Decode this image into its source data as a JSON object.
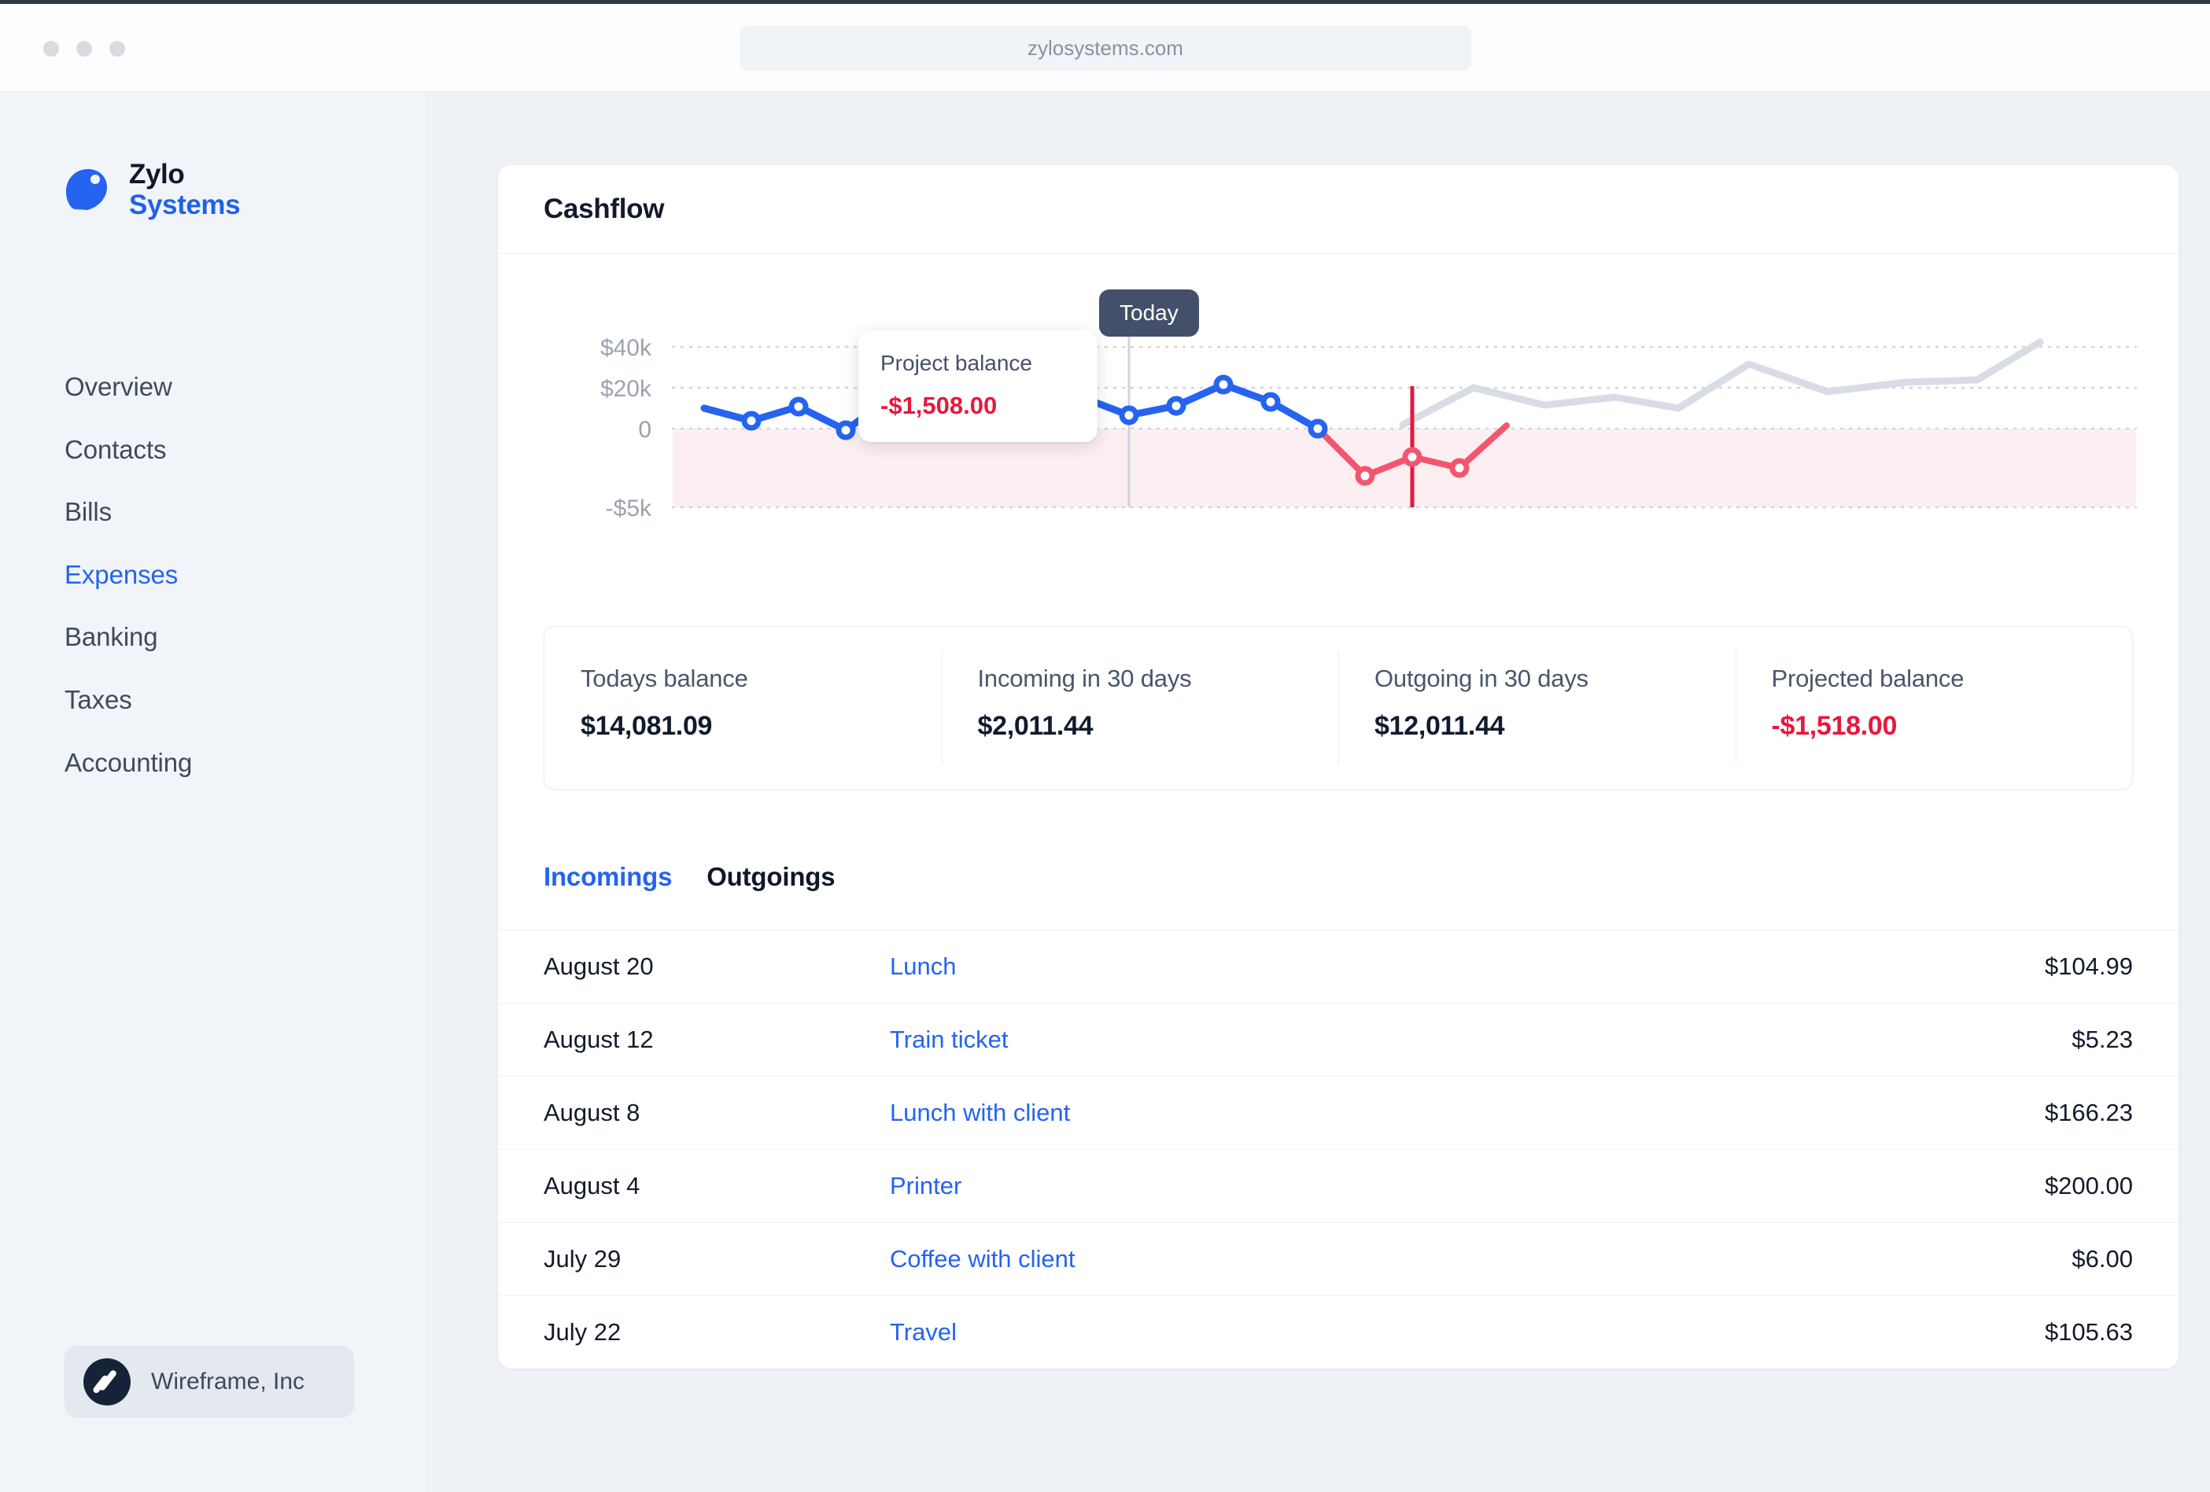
{
  "browser": {
    "url": "zylosystems.com"
  },
  "sidebar": {
    "brand": {
      "line1": "Zylo",
      "line2": "Systems"
    },
    "items": [
      {
        "label": "Overview",
        "active": false
      },
      {
        "label": "Contacts",
        "active": false
      },
      {
        "label": "Bills",
        "active": false
      },
      {
        "label": "Expenses",
        "active": true
      },
      {
        "label": "Banking",
        "active": false
      },
      {
        "label": "Taxes",
        "active": false
      },
      {
        "label": "Accounting",
        "active": false
      }
    ],
    "org": {
      "name": "Wireframe, Inc"
    }
  },
  "card": {
    "title": "Cashflow"
  },
  "chart_annotations": {
    "today_label": "Today",
    "tooltip_label": "Project balance",
    "tooltip_value": "-$1,508.00"
  },
  "stats": [
    {
      "label": "Todays balance",
      "value": "$14,081.09",
      "negative": false
    },
    {
      "label": "Incoming in 30 days",
      "value": "$2,011.44",
      "negative": false
    },
    {
      "label": "Outgoing in 30 days",
      "value": "$12,011.44",
      "negative": false
    },
    {
      "label": "Projected balance",
      "value": "-$1,518.00",
      "negative": true
    }
  ],
  "tabs": [
    {
      "label": "Incomings",
      "active": true
    },
    {
      "label": "Outgoings",
      "active": false
    }
  ],
  "transactions": [
    {
      "date": "August 20",
      "description": "Lunch",
      "amount": "$104.99"
    },
    {
      "date": "August 12",
      "description": "Train ticket",
      "amount": "$5.23"
    },
    {
      "date": "August 8",
      "description": "Lunch with client",
      "amount": "$166.23"
    },
    {
      "date": "August 4",
      "description": "Printer",
      "amount": "$200.00"
    },
    {
      "date": "July 29",
      "description": "Coffee with client",
      "amount": "$6.00"
    },
    {
      "date": "July 22",
      "description": "Travel",
      "amount": "$105.63"
    }
  ],
  "colors": {
    "accent": "#2563f0",
    "danger": "#e8173d",
    "danger_band": "#fdeef1",
    "projection": "#d8dde5",
    "today_pill": "#44506a"
  },
  "chart_data": {
    "type": "line",
    "title": "Cashflow",
    "xlabel": "",
    "ylabel": "",
    "ylim": [
      -5000,
      45000
    ],
    "yticks": [
      40000,
      20000,
      0,
      -5000
    ],
    "ytick_labels": [
      "$40k",
      "$20k",
      "0",
      "-$5k"
    ],
    "grid": "dotted-horizontal",
    "legend": "none",
    "today_index": 11,
    "negative_band": [
      -5000,
      0
    ],
    "series": [
      {
        "name": "Actual balance",
        "color": "#2563f0",
        "markers": true,
        "x": [
          0,
          1,
          2,
          3,
          4,
          5,
          6,
          7,
          8,
          9,
          10,
          11,
          12,
          13,
          14,
          15
        ],
        "values": [
          9500,
          6500,
          9800,
          1200,
          16500,
          7800,
          16000,
          20900,
          16200,
          9400,
          12800,
          9400,
          20800,
          13500,
          500,
          -4000
        ]
      },
      {
        "name": "Projected negative",
        "color": "#f2566f",
        "markers": true,
        "x": [
          15,
          16,
          17,
          18
        ],
        "values": [
          -4000,
          -1508,
          -2900,
          200
        ]
      },
      {
        "name": "Forecast",
        "color": "#d8dde5",
        "markers": false,
        "x": [
          18,
          19,
          20,
          21,
          22,
          23,
          24,
          25,
          26,
          27
        ],
        "values": [
          200,
          16500,
          12000,
          14500,
          11800,
          24000,
          18500,
          20500,
          21000,
          40000
        ]
      }
    ],
    "annotations": [
      {
        "type": "vline",
        "label": "Today",
        "x_index": 11,
        "color": "#cfd5de"
      },
      {
        "type": "vline",
        "label": "Project balance",
        "value": "-$1,508.00",
        "x_index": 16,
        "color": "#e8173d"
      }
    ]
  }
}
